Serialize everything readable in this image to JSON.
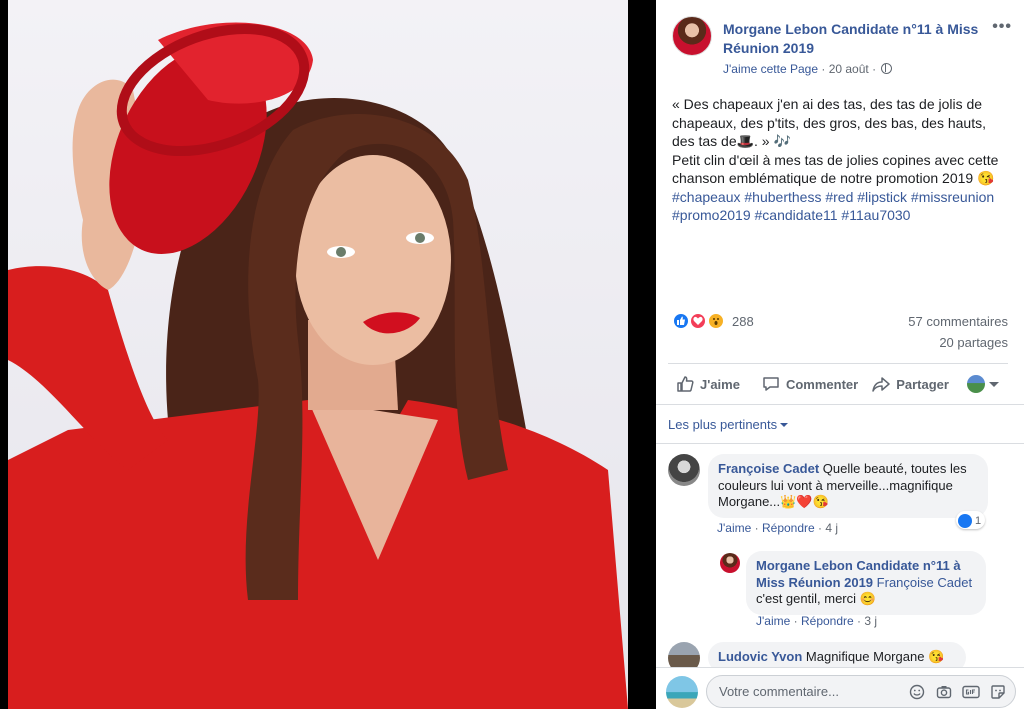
{
  "post": {
    "page_name": "Morgane Lebon Candidate n°11 à Miss Réunion 2019",
    "like_page": "J'aime cette Page",
    "date": "20 août",
    "text_lines": [
      "« Des chapeaux j'en ai des tas, des tas de jolis de chapeaux, des p'tits, des gros, des bas, des hauts, des tas de🎩. » 🎶",
      "Petit clin d'œil à mes tas de jolies copines avec cette chanson emblématique de notre promotion 2019 😘"
    ],
    "hashtags": "#chapeaux #huberthess #red #lipstick #missreunion #promo2019 #candidate11 #11au7030"
  },
  "stats": {
    "reactions": "288",
    "comments": "57 commentaires",
    "shares": "20 partages"
  },
  "actions": {
    "like": "J'aime",
    "comment": "Commenter",
    "share": "Partager"
  },
  "sort": {
    "label": "Les plus pertinents"
  },
  "comments": [
    {
      "author": "Françoise Cadet",
      "text": "Quelle beauté, toutes les couleurs lui vont à merveille...magnifique Morgane...👑❤️😘",
      "like": "J'aime",
      "reply": "Répondre",
      "time": "4 j",
      "reactions": "1"
    },
    {
      "author": "Morgane Lebon Candidate n°11 à Miss Réunion 2019",
      "tag": "Françoise Cadet",
      "text": "c'est gentil, merci 😊",
      "like": "J'aime",
      "reply": "Répondre",
      "time": "3 j"
    },
    {
      "author": "Ludovic Yvon",
      "text": "Magnifique Morgane 😘"
    }
  ],
  "composer": {
    "placeholder": "Votre commentaire..."
  },
  "colors": {
    "link_blue": "#385898",
    "meta_gray": "#606770",
    "bubble_bg": "#f2f3f5",
    "like_blue": "#1877f2",
    "love_red": "#f33e58",
    "wow_yellow": "#f7b125"
  }
}
